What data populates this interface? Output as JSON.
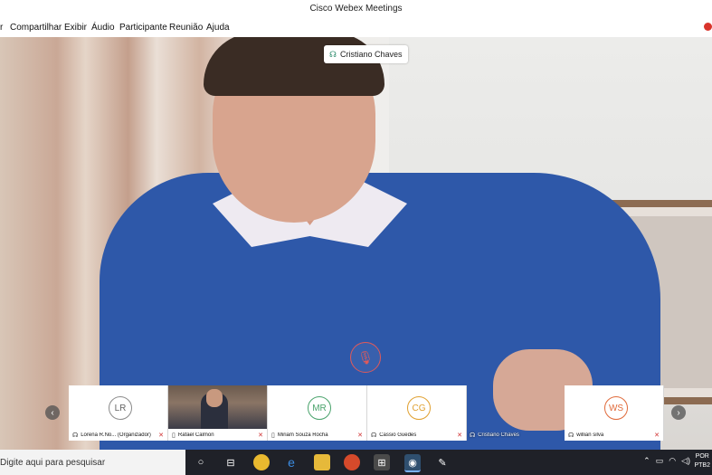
{
  "window": {
    "title": "Cisco Webex Meetings"
  },
  "menu": [
    {
      "label": "r"
    },
    {
      "label": "Compartilhar"
    },
    {
      "label": "Exibir"
    },
    {
      "label": "Áudio"
    },
    {
      "label": "Participante"
    },
    {
      "label": "Reunião"
    },
    {
      "label": "Ajuda"
    }
  ],
  "active_speaker": {
    "name": "Cristiano Chaves"
  },
  "participants": [
    {
      "initials": "LR",
      "name": "Lorena R.No... (Organizador)",
      "has_video": false,
      "muted": true
    },
    {
      "initials": "",
      "name": "Rafael Calmon",
      "has_video": true,
      "muted": true
    },
    {
      "initials": "MR",
      "name": "Miriam Souza Rocha",
      "has_video": false,
      "muted": true
    },
    {
      "initials": "CG",
      "name": "Cassio Guedes",
      "has_video": false,
      "muted": true
    },
    {
      "initials": "",
      "name": "Cristiano Chaves",
      "has_video": false,
      "muted": false
    },
    {
      "initials": "WS",
      "name": "willian silva",
      "has_video": false,
      "muted": true
    }
  ],
  "avatar_colors": {
    "LR": "#8a8a8a",
    "MR": "#4aa36c",
    "CG": "#e0a030",
    "WS": "#e06a3a"
  },
  "taskbar": {
    "search_placeholder": "Digite aqui para pesquisar",
    "language": "POR",
    "keyboard": "PTB2"
  },
  "icons": {
    "mic_muted": "mic-muted-icon",
    "nav_prev": "chevron-left-icon",
    "nav_next": "chevron-right-icon"
  }
}
